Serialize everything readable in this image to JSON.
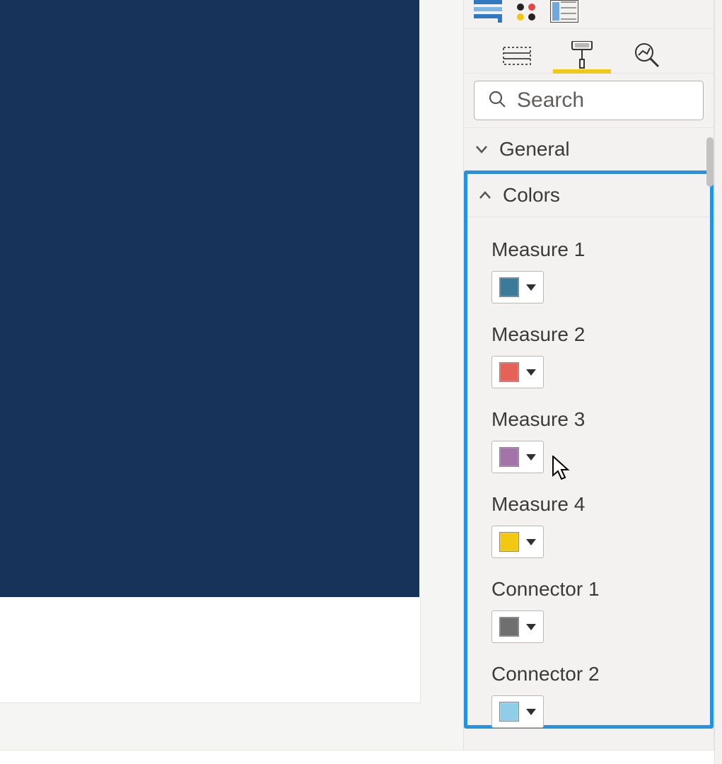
{
  "panel": {
    "tabs": {
      "fields": "fields-icon",
      "format": "format-icon",
      "analytics": "analytics-icon",
      "active": "format"
    },
    "search_placeholder": "Search"
  },
  "sections": {
    "general_label": "General",
    "colors_label": "Colors"
  },
  "colors": [
    {
      "label": "Measure 1",
      "hex": "#3b7a99"
    },
    {
      "label": "Measure 2",
      "hex": "#e66158"
    },
    {
      "label": "Measure 3",
      "hex": "#a374a8"
    },
    {
      "label": "Measure 4",
      "hex": "#f2c811"
    },
    {
      "label": "Connector 1",
      "hex": "#6f6f6f"
    },
    {
      "label": "Connector 2",
      "hex": "#90cde8"
    }
  ]
}
